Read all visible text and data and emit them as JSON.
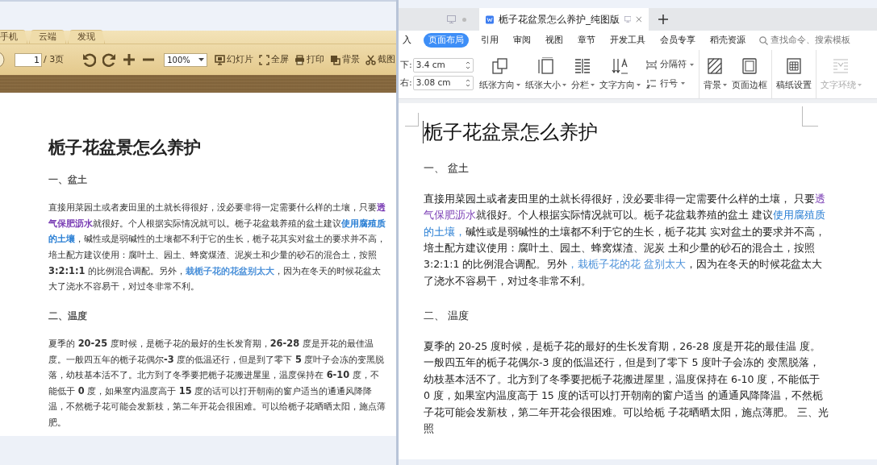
{
  "reader": {
    "tabs": [
      {
        "label": "手机"
      },
      {
        "label": "云端"
      },
      {
        "label": "发现"
      }
    ],
    "toolbar": {
      "page_value": "1",
      "page_total": "/ 3页",
      "zoom": "100%",
      "buttons": [
        {
          "label": "幻灯片",
          "kind": "slideshow"
        },
        {
          "label": "全屏",
          "kind": "fullscreen"
        },
        {
          "label": "打印",
          "kind": "print"
        },
        {
          "label": "背景",
          "kind": "background"
        },
        {
          "label": "截图",
          "kind": "screenshot"
        }
      ]
    },
    "document": {
      "title": "栀子花盆景怎么养护",
      "blocks": [
        {
          "kind": "heading",
          "text": "一、盆土"
        },
        {
          "kind": "paragraph",
          "segments": [
            {
              "text": "直接用菜园土或者麦田里的土就长得很好，没必要非得一定需要什么样的土壤，只要"
            },
            {
              "text": "透气保肥沥水",
              "color": "#7b3fb5"
            },
            {
              "text": "就很好。个人根据实际情况就可以。栀子花盆栽养殖的盆土建议"
            },
            {
              "text": "使用腐殖质的土壤",
              "color": "#2a7fd4"
            },
            {
              "text": "，碱性或是弱碱性的土壤都不利于它的生长，栀子花其实对盆土的要求并不高，培土配方建议使用：腐叶土、园土、蜂窝煤渣、泥炭土和少量的砂石的混合土，按照 **3:2:1:1** 的比例混合调配。另外，"
            },
            {
              "text": "栽栀子花的花盆别太大",
              "color": "#4a90d9"
            },
            {
              "text": "，因为在冬天的时候花盆太大了浇水不容易干，对过冬非常不利。"
            }
          ]
        },
        {
          "kind": "heading",
          "text": "二、温度"
        },
        {
          "kind": "paragraph",
          "segments": [
            {
              "text": "夏季的 **20-25** 度时候，是栀子花的最好的生长发育期，**26-28** 度是开花的最佳温度。一般四五年的栀子花偶尔**-3** 度的低温还行，但是到了零下 **5** 度叶子会冻的变黑脱落，幼枝基本活不了。北方到了冬季要把栀子花搬进屋里，温度保持在 **6-10** 度，不能低于 **0** 度，如果室内温度高于 **15** 度的话可以打开朝南的窗户适当的通通风降降温，不然栀子花可能会发新枝，第二年开花会很困难。可以给栀子花晒晒太阳，施点薄肥。"
            }
          ]
        }
      ]
    }
  },
  "editor": {
    "doc_tab": {
      "title": "栀子花盆景怎么养护_纯图版"
    },
    "ribbon_tabs": [
      {
        "label": "入",
        "selected": false
      },
      {
        "label": "页面布局",
        "selected": true
      },
      {
        "label": "引用",
        "selected": false
      },
      {
        "label": "审阅",
        "selected": false
      },
      {
        "label": "视图",
        "selected": false
      },
      {
        "label": "章节",
        "selected": false
      },
      {
        "label": "开发工具",
        "selected": false
      },
      {
        "label": "会员专享",
        "selected": false
      },
      {
        "label": "稻壳资源",
        "selected": false
      }
    ],
    "search": {
      "placeholder": "查找命令、搜索模板"
    },
    "margins": [
      {
        "label": "下:",
        "value": "3.4 cm"
      },
      {
        "label": "右:",
        "value": "3.08 cm"
      }
    ],
    "groups": [
      [
        {
          "label": "纸张方向",
          "kind": "orientation",
          "dropdown": true,
          "disabled": false
        },
        {
          "label": "纸张大小",
          "kind": "size",
          "dropdown": true,
          "disabled": false
        },
        {
          "label": "分栏",
          "kind": "columns",
          "dropdown": true,
          "disabled": false
        },
        {
          "label": "文字方向",
          "kind": "text-direction",
          "dropdown": true,
          "disabled": false
        },
        {
          "kind": "stack",
          "items": [
            {
              "label": "分隔符",
              "kind": "break",
              "dropdown": true
            },
            {
              "label": "行号",
              "kind": "line-numbers",
              "dropdown": true
            }
          ]
        }
      ],
      [
        {
          "label": "背景",
          "kind": "background",
          "dropdown": true,
          "disabled": false
        },
        {
          "label": "页面边框",
          "kind": "border",
          "dropdown": false,
          "disabled": false
        }
      ],
      [
        {
          "label": "稿纸设置",
          "kind": "grid-paper",
          "dropdown": false,
          "disabled": false
        }
      ],
      [
        {
          "label": "文字环绕",
          "kind": "wrap",
          "dropdown": true,
          "disabled": true
        }
      ]
    ],
    "document": {
      "title": "栀子花盆景怎么养护",
      "blocks": [
        {
          "kind": "heading",
          "text": "一、 盆土"
        },
        {
          "kind": "paragraph",
          "segments": [
            {
              "text": "直接用菜园土或者麦田里的土就长得很好，没必要非得一定需要什么样的土壤， 只要"
            },
            {
              "text": "透气保肥沥水",
              "color": "#7b3fb5"
            },
            {
              "text": "就很好。个人根据实际情况就可以。栀子花盆栽养殖的盆土 建议"
            },
            {
              "text": "使用腐殖质的土壤，",
              "color": "#2a7fd4"
            },
            {
              "text": "碱性或是弱碱性的土壤都不利于它的生长，栀子花其 实对盆土的要求并不高，培土配方建议使用：腐叶土、园土、蜂窝煤渣、泥炭 土和少量的砂石的混合土，按照3:2:1:1 的比例混合调配。另外"
            },
            {
              "text": "，栽栀子花的花 盆别太大",
              "color": "#4a90d9"
            },
            {
              "text": "，因为在冬天的时候花盆太大了浇水不容易干，对过冬非常不利。"
            }
          ]
        },
        {
          "kind": "heading",
          "text": "二、 温度"
        },
        {
          "kind": "paragraph",
          "segments": [
            {
              "text": "夏季的 20-25 度时候，是栀子花的最好的生长发育期，26-28 度是开花的最佳温 度。一般四五年的栀子花偶尔-3 度的低温还行，但是到了零下 5 度叶子会冻的 变黑脱落，幼枝基本活不了。北方到了冬季要把栀子花搬进屋里，温度保持在 6-10 度，不能低于 0 度，如果室内温度高于 15 度的话可以打开朝南的窗户适当 的通通风降降温，不然栀子花可能会发新枝，第二年开花会很困难。可以给栀 子花晒晒太阳，施点薄肥。 三、光照"
            }
          ]
        }
      ]
    }
  }
}
